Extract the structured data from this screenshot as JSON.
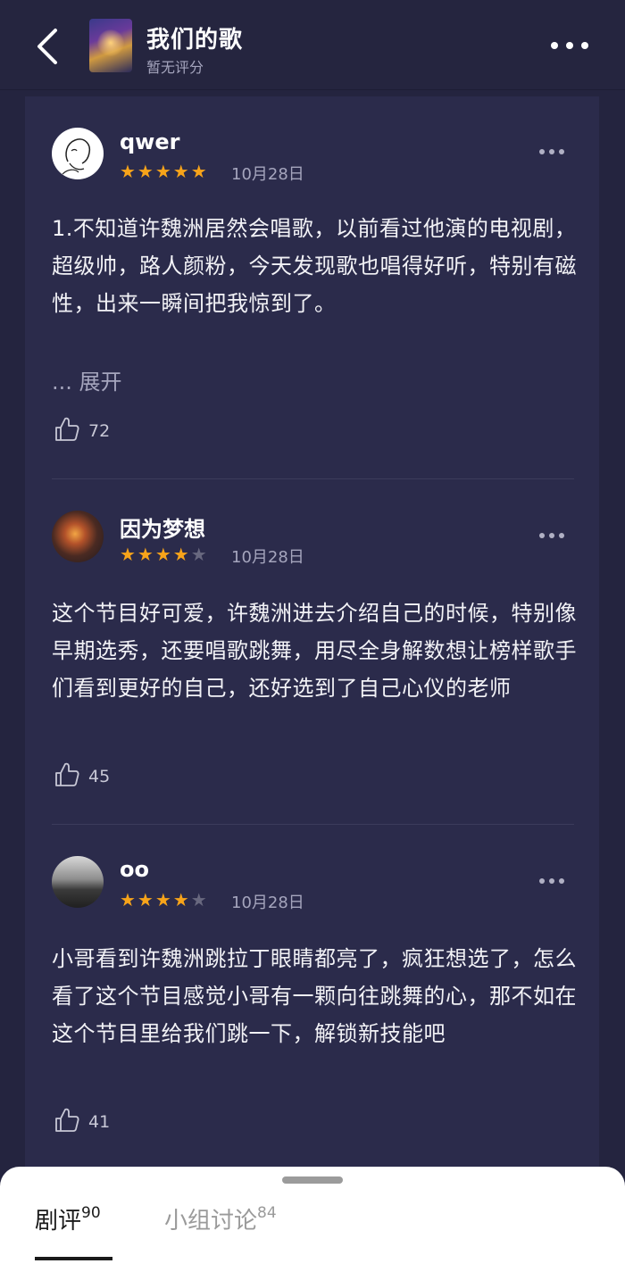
{
  "header": {
    "title": "我们的歌",
    "subtitle": "暂无评分",
    "cover_icon": "album-cover",
    "back_icon": "chevron-left-icon",
    "more_icon": "more-dots-icon"
  },
  "reviews": [
    {
      "username": "qwer",
      "rating": 5,
      "stars": {
        "on": "★★★★★",
        "off": ""
      },
      "date": "10月28日",
      "body": "1.不知道许魏洲居然会唱歌，以前看过他演的电视剧，超级帅，路人颜粉，今天发现歌也唱得好听，特别有磁性，出来一瞬间把我惊到了。",
      "expand_label": "... 展开",
      "likes": "72"
    },
    {
      "username": "因为梦想",
      "rating": 4,
      "stars": {
        "on": "★★★★",
        "off": "★"
      },
      "date": "10月28日",
      "body": "这个节目好可爱，许魏洲进去介绍自己的时候，特别像早期选秀，还要唱歌跳舞，用尽全身解数想让榜样歌手们看到更好的自己，还好选到了自己心仪的老师",
      "likes": "45"
    },
    {
      "username": "oo",
      "rating": 4,
      "stars": {
        "on": "★★★★",
        "off": "★"
      },
      "date": "10月28日",
      "body": "小哥看到许魏洲跳拉丁眼睛都亮了，疯狂想选了，怎么看了这个节目感觉小哥有一颗向往跳舞的心，那不如在这个节目里给我们跳一下，解锁新技能吧",
      "likes": "41"
    }
  ],
  "tabs": [
    {
      "label": "剧评",
      "count": "90",
      "active": true
    },
    {
      "label": "小组讨论",
      "count": "84",
      "active": false
    }
  ],
  "colors": {
    "background": "#24243f",
    "card": "#2b2b4b",
    "star": "#f7a41a",
    "muted_text": "#a5a5bd"
  }
}
